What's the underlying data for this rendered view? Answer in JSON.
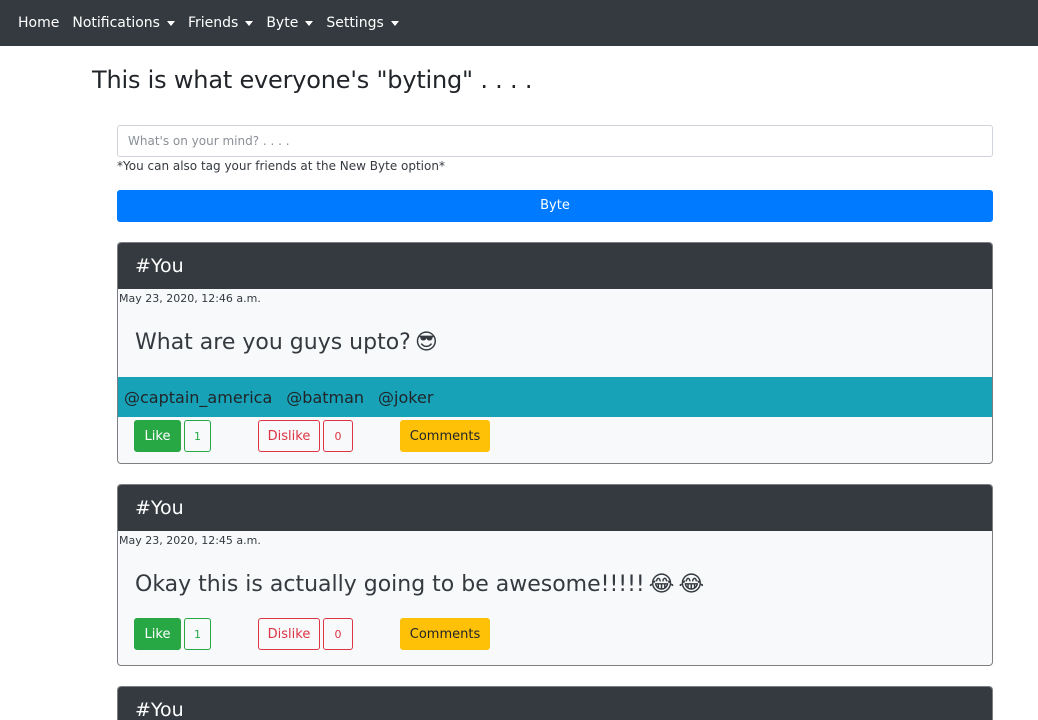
{
  "nav": {
    "items": [
      {
        "label": "Home",
        "dropdown": false
      },
      {
        "label": "Notifications",
        "dropdown": true
      },
      {
        "label": "Friends",
        "dropdown": true
      },
      {
        "label": "Byte",
        "dropdown": true
      },
      {
        "label": "Settings",
        "dropdown": true
      }
    ]
  },
  "page": {
    "headline": "This is what everyone's \"byting\" . . . ."
  },
  "composer": {
    "placeholder": "What's on your mind? . . . .",
    "hint": "*You can also tag your friends at the New Byte option*",
    "submit_label": "Byte"
  },
  "posts": [
    {
      "author": "#You",
      "timestamp": "May 23, 2020, 12:46 a.m.",
      "text": "What are you guys upto?",
      "emojis": [
        "😎"
      ],
      "tags": [
        "@captain_america",
        "@batman",
        "@joker"
      ],
      "like_label": "Like",
      "likes": "1",
      "dislike_label": "Dislike",
      "dislikes": "0",
      "comments_label": "Comments"
    },
    {
      "author": "#You",
      "timestamp": "May 23, 2020, 12:45 a.m.",
      "text": "Okay this is actually going to be awesome!!!!!",
      "emojis": [
        "😂",
        "😂"
      ],
      "tags": [],
      "like_label": "Like",
      "likes": "1",
      "dislike_label": "Dislike",
      "dislikes": "0",
      "comments_label": "Comments"
    },
    {
      "author": "#You"
    }
  ],
  "colors": {
    "navbar": "#343a40",
    "primary": "#007bff",
    "success": "#28a745",
    "danger": "#dc3545",
    "warning": "#ffc107",
    "info": "#17a2b8"
  }
}
